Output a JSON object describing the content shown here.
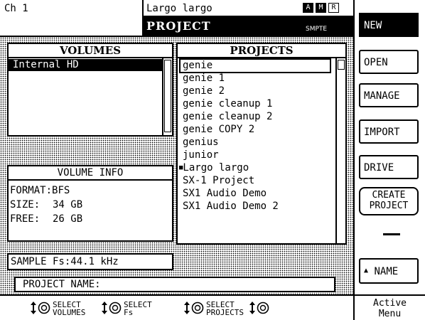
{
  "header": {
    "channel": "Ch 1",
    "project_name": "Largo largo",
    "screen_title": "PROJECT",
    "indicators": [
      "A",
      "M",
      "R"
    ],
    "sync": "SMPTE"
  },
  "volumes": {
    "heading": "VOLUMES",
    "items": [
      "Internal HD"
    ],
    "selected_index": 0
  },
  "projects": {
    "heading": "PROJECTS",
    "items": [
      "genie",
      "genie 1",
      "genie 2",
      "genie cleanup 1",
      "genie cleanup 2",
      "genie COPY 2",
      "genius",
      "junior",
      "Largo largo",
      "SX-1 Project",
      "SX1 Audio Demo",
      "SX1 Audio Demo 2"
    ],
    "current_marker_index": 8,
    "cursor_index": 0
  },
  "volume_info": {
    "heading": "VOLUME INFO",
    "format_label": "FORMAT:",
    "format_value": "BFS",
    "size_label": "SIZE:",
    "size_value": "34 GB",
    "free_label": "FREE:",
    "free_value": "26 GB"
  },
  "sample_fs": "SAMPLE Fs:44.1 kHz",
  "project_name_field": {
    "label": "PROJECT NAME:",
    "value": ""
  },
  "side_buttons": {
    "new": "NEW",
    "open": "OPEN",
    "manage": "MANAGE",
    "import": "IMPORT",
    "drive": "DRIVE",
    "create_line1": "CREATE",
    "create_line2": "PROJECT",
    "dash": "—",
    "name": "NAME",
    "active_line1": "Active",
    "active_line2": "Menu"
  },
  "footer": {
    "select_volumes_1": "SELECT",
    "select_volumes_2": "VOLUMES",
    "select_fs_1": "SELECT",
    "select_fs_2": "Fs",
    "select_projects_1": "SELECT",
    "select_projects_2": "PROJECTS"
  }
}
